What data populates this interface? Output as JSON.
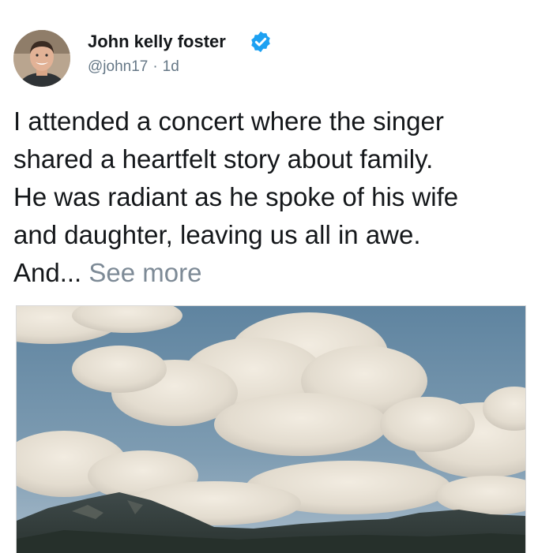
{
  "tweet": {
    "author": {
      "display_name": "John kelly foster",
      "verified": true,
      "handle": "@john17",
      "time_separator": "·",
      "age": "1d",
      "avatar": "profile-photo"
    },
    "text_lines": [
      "I attended a concert where the singer",
      "shared a heartfelt story about family.",
      "He was radiant as he spoke of his wife",
      "and daughter, leaving us all in awe.",
      "And..."
    ],
    "see_more": "See more",
    "media": {
      "type": "photo",
      "subject": "clouds-over-mountains"
    }
  },
  "colors": {
    "text": "#14171a",
    "secondary_text": "#657786",
    "see_more": "#7d8a96",
    "verified_badge": "#1da1f2",
    "sky": "#6f8fa8"
  }
}
